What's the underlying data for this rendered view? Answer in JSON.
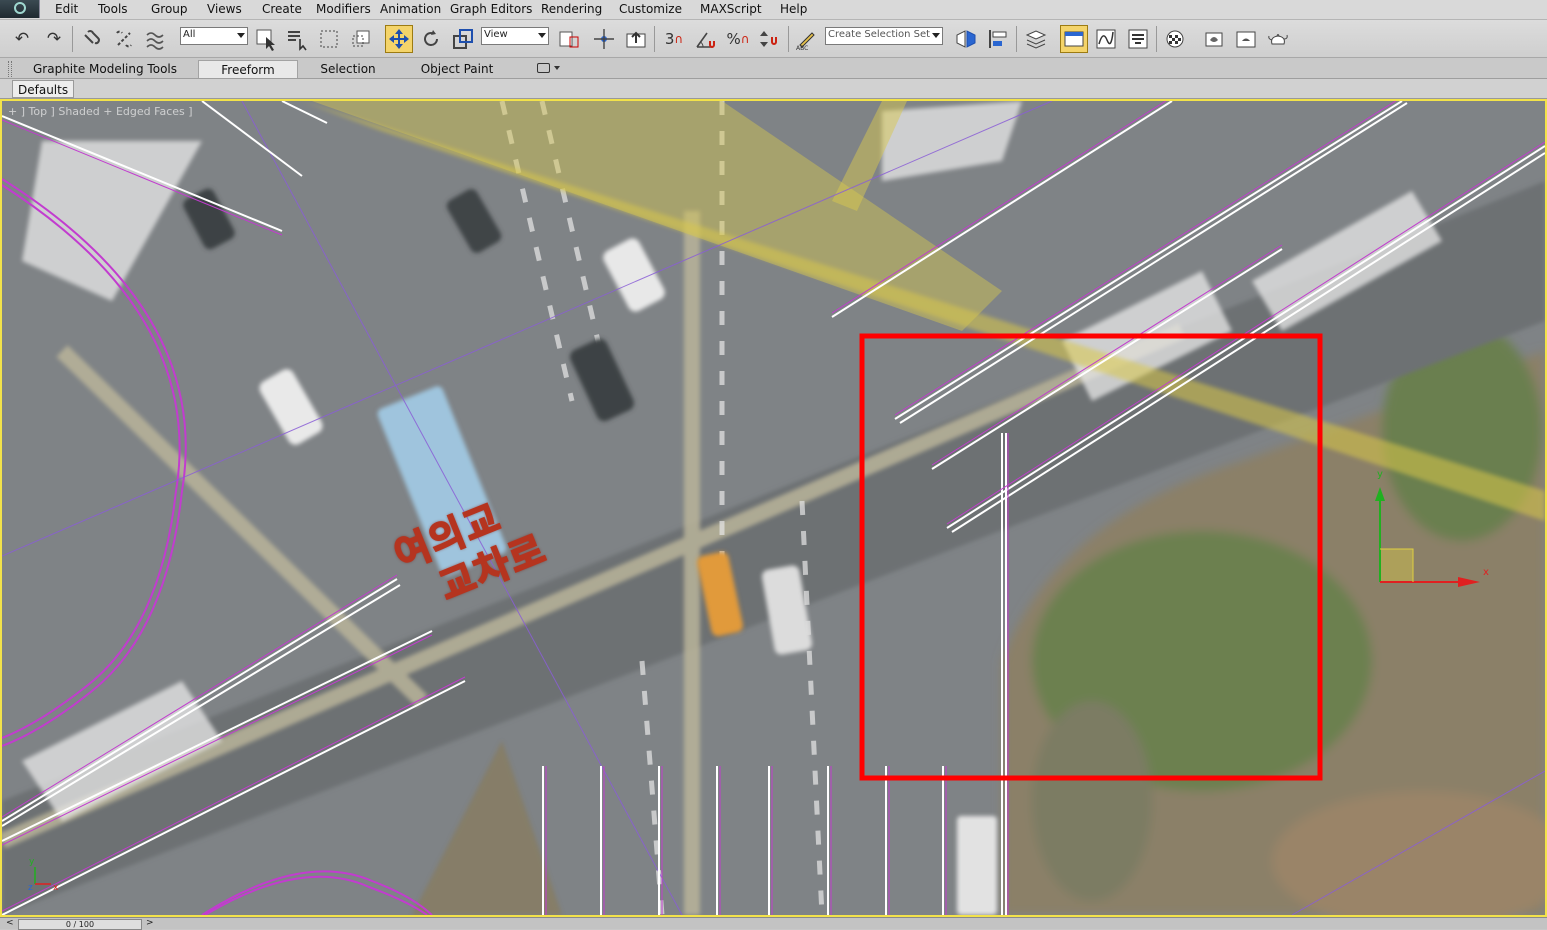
{
  "menu": [
    "Edit",
    "Tools",
    "Group",
    "Views",
    "Create",
    "Modifiers",
    "Animation",
    "Graph Editors",
    "Rendering",
    "Customize",
    "MAXScript",
    "Help"
  ],
  "toolbar": {
    "selection_filter": "All",
    "reference_coord": "View",
    "named_selection_placeholder": "Create Selection Set",
    "snap_label": "3"
  },
  "ribbon": {
    "tabs": [
      "Graphite Modeling Tools",
      "Freeform",
      "Selection",
      "Object Paint"
    ],
    "active_tab": "Freeform"
  },
  "defaults_label": "Defaults",
  "viewport": {
    "label": "+ ] Top ] Shaded + Edged Faces ]",
    "sign_line1": "여의교",
    "sign_line2": "교차로",
    "highlight_color": "#ff0000",
    "frame_color": "#f2e24a",
    "spline_color": "#cc33cc",
    "gizmo_axes": {
      "y": "y",
      "x": "x"
    },
    "corner_axes": {
      "y": "y",
      "z": "z",
      "x": "x"
    }
  },
  "status": {
    "frame_counter": "0 / 100",
    "prev": "<",
    "next": ">"
  }
}
